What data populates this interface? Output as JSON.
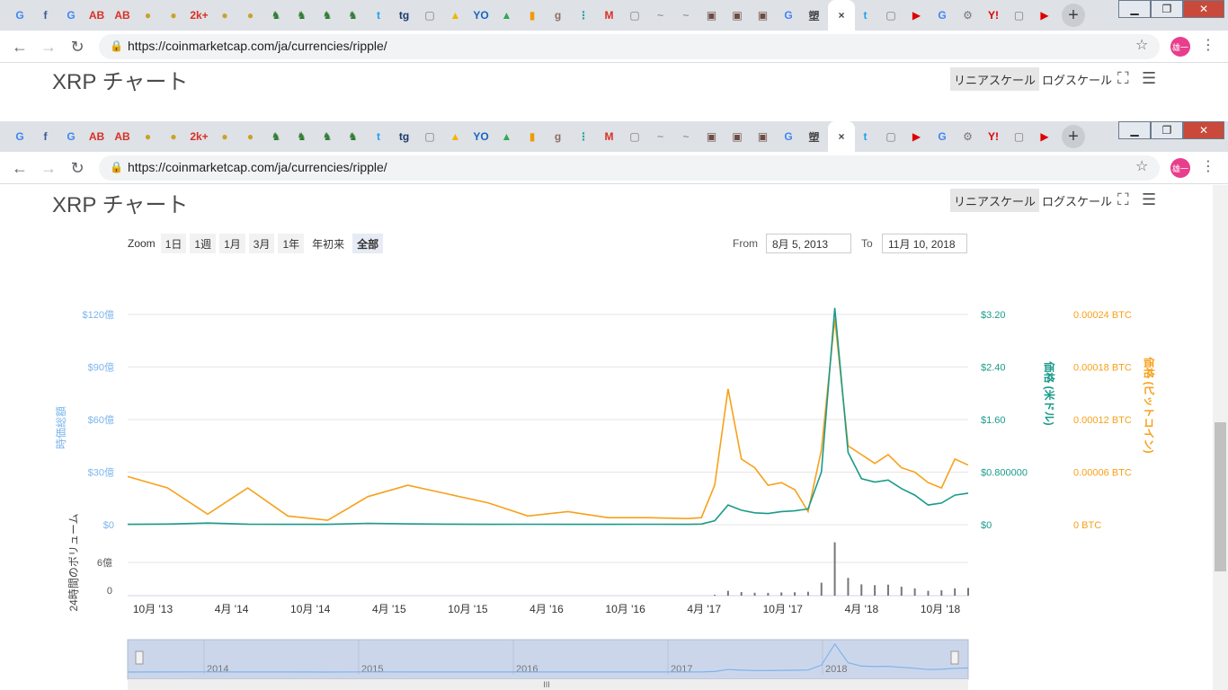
{
  "browser": {
    "tabs": [
      "G",
      "f",
      "G",
      "AB",
      "AB",
      "●",
      "●",
      "2k+",
      "●",
      "●",
      "♞",
      "♞",
      "♞",
      "♞",
      "t",
      "tg",
      "▢",
      "▲",
      "YO",
      "▲",
      "▮",
      "g",
      "⋮",
      "M",
      "▢",
      "~",
      "~",
      "▣",
      "▣",
      "▣",
      "G",
      "塑",
      "×",
      "t",
      "▢",
      "▶",
      "G",
      "⚙",
      "Y!",
      "▢",
      "▶"
    ],
    "url": "https://coinmarketcap.com/ja/currencies/ripple/",
    "avatar": "雄一",
    "win_min": "▁",
    "win_max": "❐",
    "win_close": "✕",
    "new_tab": "+"
  },
  "page": {
    "title": "XRP チャート",
    "linear_scale": "リニアスケール",
    "log_scale": "ログスケール",
    "zoom_label": "Zoom",
    "zoom_buttons": [
      "1日",
      "1週",
      "1月",
      "3月",
      "1年",
      "年初来",
      "全部"
    ],
    "from_label": "From",
    "from_value": "8月 5, 2013",
    "to_label": "To",
    "to_value": "11月 10, 2018"
  },
  "chart_data": {
    "type": "line",
    "left_axis_title": "時価総額",
    "left_ticks": [
      "$120億",
      "$90億",
      "$60億",
      "$30億",
      "$0"
    ],
    "usd_axis_title": "価格 (米ドル)",
    "usd_ticks": [
      "$3.20",
      "$2.40",
      "$1.60",
      "$0.800000",
      "$0"
    ],
    "btc_axis_title": "価格 (ビットコイン)",
    "btc_ticks": [
      "0.00024 BTC",
      "0.00018 BTC",
      "0.00012 BTC",
      "0.00006 BTC",
      "0 BTC"
    ],
    "volume_axis_title": "24時間のボリューム",
    "volume_ticks": [
      "6億",
      "0"
    ],
    "x_ticks": [
      "10月 '13",
      "4月 '14",
      "10月 '14",
      "4月 '15",
      "10月 '15",
      "4月 '16",
      "10月 '16",
      "4月 '17",
      "10月 '17",
      "4月 '18",
      "10月 '18"
    ],
    "navigator_years": [
      "2014",
      "2015",
      "2016",
      "2017",
      "2018"
    ],
    "colors": {
      "market_cap": "#7cb5ec",
      "price_usd": "#1a9b8a",
      "price_btc": "#f7a11a",
      "volume": "#777777"
    },
    "series": [
      {
        "name": "価格 (米ドル)",
        "unit": "USD",
        "x": [
          "2013-08",
          "2013-11",
          "2014-02",
          "2014-05",
          "2014-08",
          "2014-11",
          "2015-02",
          "2015-05",
          "2015-08",
          "2015-11",
          "2016-02",
          "2016-05",
          "2016-08",
          "2016-11",
          "2017-02",
          "2017-03",
          "2017-04",
          "2017-05",
          "2017-06",
          "2017-07",
          "2017-08",
          "2017-09",
          "2017-10",
          "2017-11",
          "2017-12",
          "2018-01",
          "2018-02",
          "2018-03",
          "2018-04",
          "2018-05",
          "2018-06",
          "2018-07",
          "2018-08",
          "2018-09",
          "2018-10",
          "2018-11"
        ],
        "y": [
          0.005,
          0.01,
          0.025,
          0.008,
          0.006,
          0.005,
          0.02,
          0.012,
          0.008,
          0.006,
          0.007,
          0.006,
          0.006,
          0.007,
          0.006,
          0.009,
          0.06,
          0.3,
          0.22,
          0.18,
          0.17,
          0.2,
          0.21,
          0.24,
          0.8,
          3.3,
          1.1,
          0.7,
          0.65,
          0.68,
          0.55,
          0.45,
          0.3,
          0.33,
          0.45,
          0.48
        ]
      },
      {
        "name": "価格 (ビットコイン)",
        "unit": "BTC",
        "x": [
          "2013-08",
          "2013-11",
          "2014-02",
          "2014-05",
          "2014-08",
          "2014-11",
          "2015-02",
          "2015-05",
          "2015-08",
          "2015-11",
          "2016-02",
          "2016-05",
          "2016-08",
          "2016-11",
          "2017-02",
          "2017-03",
          "2017-04",
          "2017-05",
          "2017-06",
          "2017-07",
          "2017-08",
          "2017-09",
          "2017-10",
          "2017-11",
          "2017-12",
          "2018-01",
          "2018-02",
          "2018-03",
          "2018-04",
          "2018-05",
          "2018-06",
          "2018-07",
          "2018-08",
          "2018-09",
          "2018-10",
          "2018-11"
        ],
        "y": [
          5.5e-05,
          4.2e-05,
          1.2e-05,
          4.2e-05,
          1e-05,
          5e-06,
          3.2e-05,
          4.5e-05,
          3.5e-05,
          2.5e-05,
          1e-05,
          1.5e-05,
          8e-06,
          8e-06,
          7e-06,
          8e-06,
          4.5e-05,
          0.000155,
          7.5e-05,
          6.5e-05,
          4.5e-05,
          4.8e-05,
          4e-05,
          1.5e-05,
          8.5e-05,
          0.000235,
          9e-05,
          8e-05,
          7e-05,
          8e-05,
          6.5e-05,
          6e-05,
          4.8e-05,
          4.2e-05,
          7.5e-05,
          6.8e-05
        ]
      }
    ]
  }
}
